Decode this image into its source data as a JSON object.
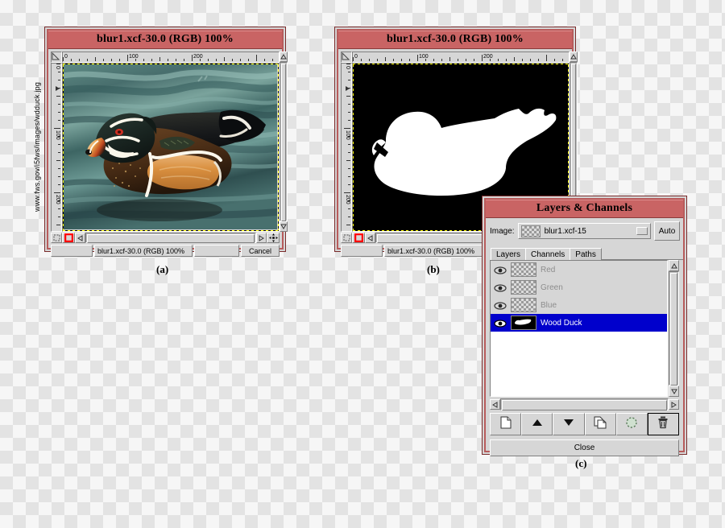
{
  "figure": {
    "labels": {
      "a": "(a)",
      "b": "(b)",
      "c": "(c)"
    },
    "credit": "www.fws.gov/i5fws/images/wdduck.jpg"
  },
  "image_window_a": {
    "title": "blur1.xcf-30.0 (RGB) 100%",
    "ruler_ticks": [
      "0",
      "100",
      "200"
    ],
    "ruler_ticks_v": [
      "0",
      "100",
      "200"
    ],
    "status": {
      "left": "",
      "center": "blur1.xcf-30.0 (RGB) 100%",
      "right": "",
      "cancel_label": "Cancel"
    },
    "icons": {
      "corner": "triangle-ruler-icon",
      "quickmask_off": "quickmask-off-icon",
      "quickmask_on": "quickmask-on-icon",
      "navigate": "navigation-move-icon"
    }
  },
  "image_window_b": {
    "title": "blur1.xcf-30.0 (RGB) 100%",
    "ruler_ticks": [
      "0",
      "100",
      "200"
    ],
    "status": {
      "left": "",
      "center": "blur1.xcf-30.0 (RGB) 100%",
      "right": ""
    }
  },
  "layers_channels": {
    "title": "Layers & Channels",
    "image_label": "Image:",
    "image_value": "blur1.xcf-15",
    "auto_label": "Auto",
    "tabs": [
      {
        "label": "Layers",
        "active": false
      },
      {
        "label": "Channels",
        "active": true
      },
      {
        "label": "Paths",
        "active": false
      }
    ],
    "channels": [
      {
        "name": "Red",
        "visible": true,
        "selected": false,
        "thumb": "checker"
      },
      {
        "name": "Green",
        "visible": true,
        "selected": false,
        "thumb": "checker"
      },
      {
        "name": "Blue",
        "visible": true,
        "selected": false,
        "thumb": "checker"
      },
      {
        "name": "Wood Duck",
        "visible": true,
        "selected": true,
        "thumb": "duck-mask"
      }
    ],
    "toolbar": [
      {
        "icon": "new-channel-icon",
        "name": "new-channel-button"
      },
      {
        "icon": "raise-channel-icon",
        "name": "raise-channel-button"
      },
      {
        "icon": "lower-channel-icon",
        "name": "lower-channel-button"
      },
      {
        "icon": "duplicate-channel-icon",
        "name": "duplicate-channel-button"
      },
      {
        "icon": "channel-to-selection-icon",
        "name": "channel-to-selection-button"
      },
      {
        "icon": "delete-channel-icon",
        "name": "delete-channel-button"
      }
    ],
    "close_label": "Close"
  },
  "colors": {
    "titlebar": "#c96464",
    "window_border": "#b85c5c",
    "panel": "#d6d6d6",
    "selection_blue": "#0000cc",
    "marching_ants_a": "#ffff00",
    "marching_ants_b": "#000000",
    "disabled_text": "#8d8d8d",
    "quickmask_red": "#ff0000"
  }
}
